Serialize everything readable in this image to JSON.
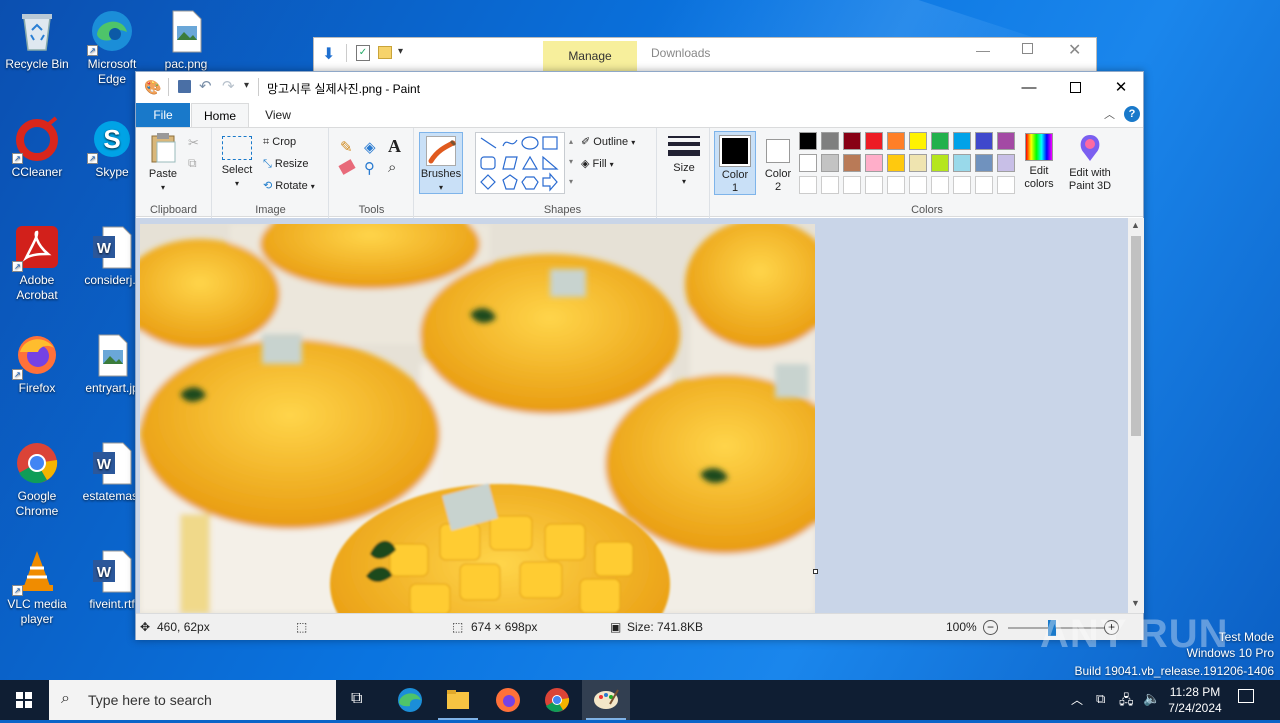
{
  "desktop": {
    "icons": [
      {
        "label": "Recycle Bin",
        "icon": "recycle-bin-icon"
      },
      {
        "label": "Microsoft Edge",
        "icon": "edge-icon"
      },
      {
        "label": "pac.png",
        "icon": "image-file-icon"
      },
      {
        "label": "CCleaner",
        "icon": "ccleaner-icon"
      },
      {
        "label": "Skype",
        "icon": "skype-icon"
      },
      {
        "label": "Adobe Acrobat",
        "icon": "acrobat-icon"
      },
      {
        "label": "considerj.r",
        "icon": "word-doc-icon"
      },
      {
        "label": "Firefox",
        "icon": "firefox-icon"
      },
      {
        "label": "entryart.jp",
        "icon": "image-file-icon"
      },
      {
        "label": "Google Chrome",
        "icon": "chrome-icon"
      },
      {
        "label": "estatemast",
        "icon": "word-doc-icon"
      },
      {
        "label": "VLC media player",
        "icon": "vlc-icon"
      },
      {
        "label": "fiveint.rtf",
        "icon": "word-doc-icon"
      }
    ]
  },
  "explorer": {
    "manage_tab": "Manage",
    "location": "Downloads"
  },
  "paint": {
    "title": "망고시루 실제사진.png - Paint",
    "tabs": {
      "file": "File",
      "home": "Home",
      "view": "View"
    },
    "ribbon": {
      "clipboard": {
        "paste": "Paste",
        "label": "Clipboard"
      },
      "image": {
        "select": "Select",
        "crop": "Crop",
        "resize": "Resize",
        "rotate": "Rotate",
        "label": "Image"
      },
      "tools": {
        "label": "Tools"
      },
      "brushes": "Brushes",
      "shapes": {
        "outline": "Outline",
        "fill": "Fill",
        "label": "Shapes"
      },
      "size": "Size",
      "colors": {
        "color1": "Color 1",
        "color2": "Color 2",
        "edit": "Edit colors",
        "paint3d": "Edit with Paint 3D",
        "label": "Colors",
        "palette_row1": [
          "#000000",
          "#7f7f7f",
          "#880015",
          "#ed1c24",
          "#ff7f27",
          "#fff200",
          "#22b14c",
          "#00a2e8",
          "#3f48cc",
          "#a349a4"
        ],
        "palette_row2": [
          "#ffffff",
          "#c3c3c3",
          "#b97a57",
          "#ffaec9",
          "#ffc90e",
          "#efe4b0",
          "#b5e61d",
          "#99d9ea",
          "#7092be",
          "#c8bfe7"
        ],
        "palette_row3": [
          "#ffffff",
          "#ffffff",
          "#ffffff",
          "#ffffff",
          "#ffffff",
          "#ffffff",
          "#ffffff",
          "#ffffff",
          "#ffffff",
          "#ffffff"
        ]
      }
    },
    "status": {
      "cursor": "460, 62px",
      "dimensions": "674 × 698px",
      "size": "Size: 741.8KB",
      "zoom": "100%",
      "zoom_level": 1.0
    }
  },
  "taskbar": {
    "search_placeholder": "Type here to search",
    "time": "11:28 PM",
    "date": "7/24/2024"
  },
  "watermark": {
    "mode": "Test Mode",
    "os": "Windows 10 Pro",
    "build": "Build 19041.vb_release.191206-1406",
    "brand": "ANY RUN"
  }
}
